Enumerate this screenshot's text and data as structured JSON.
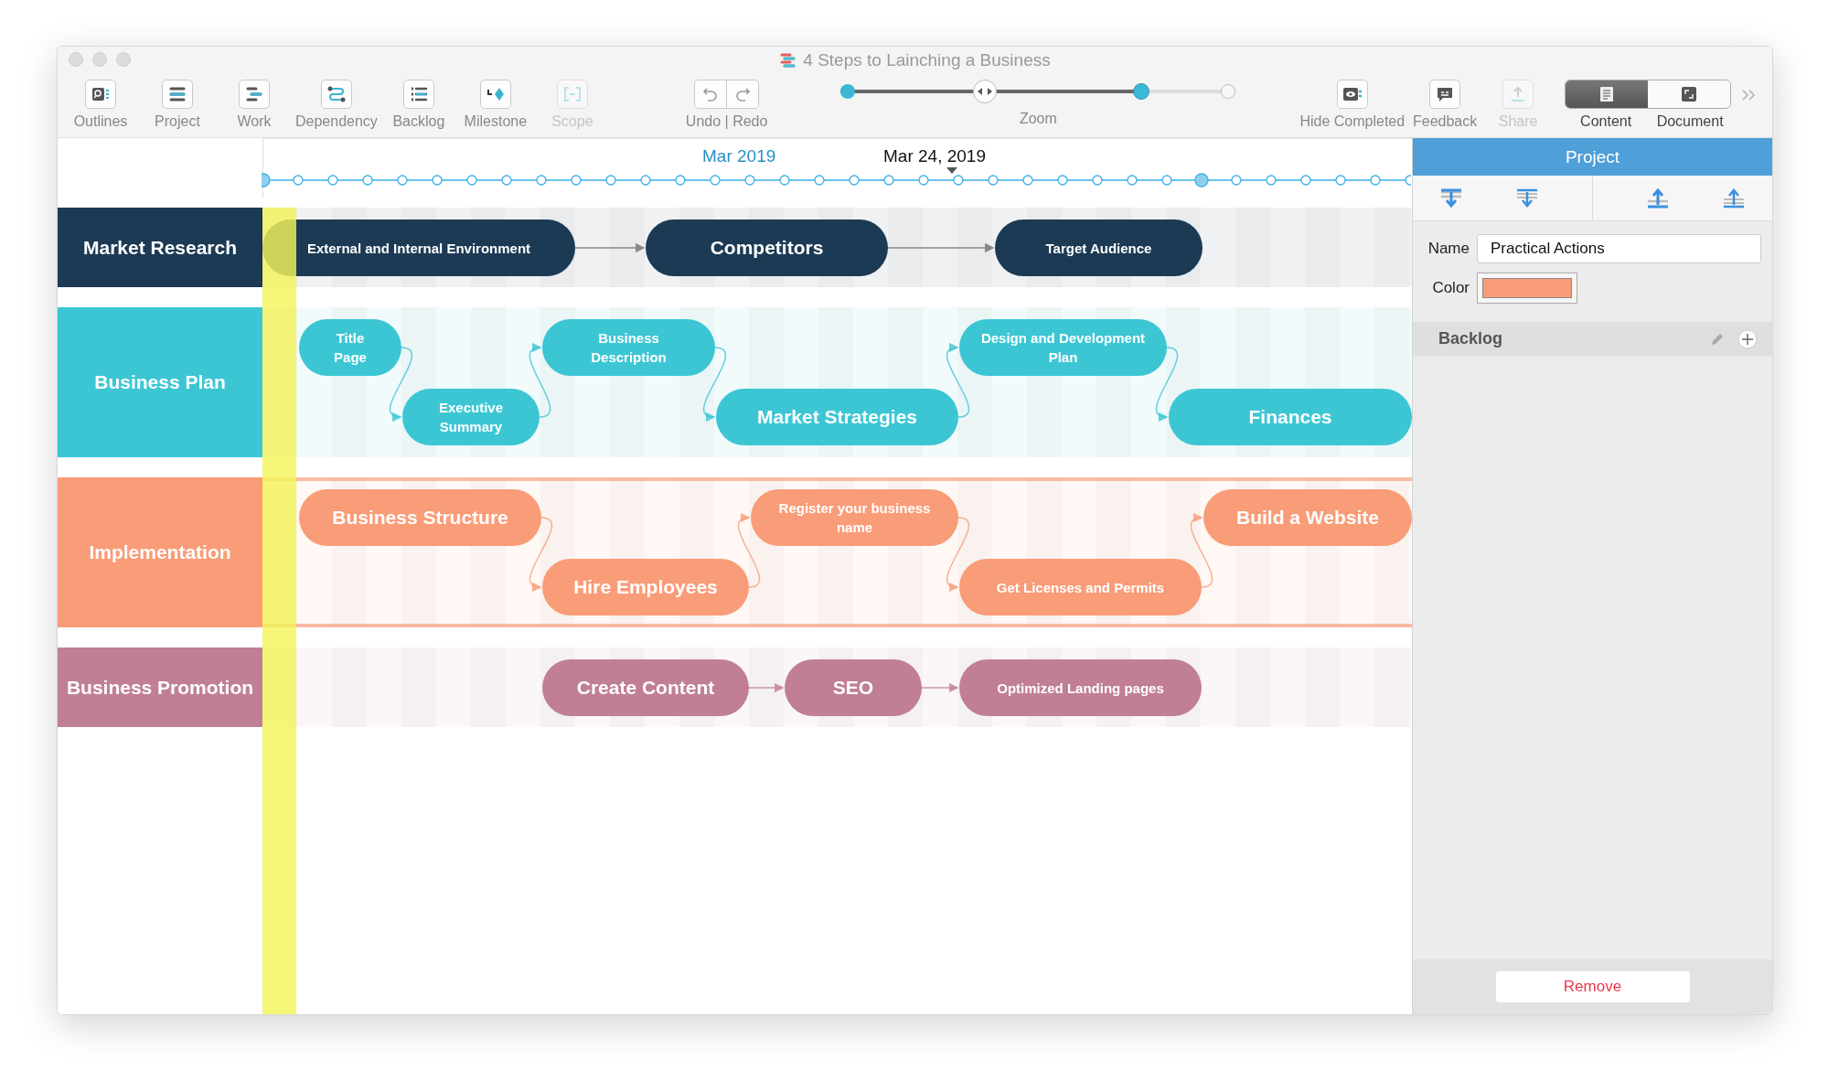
{
  "window": {
    "title": "4 Steps to Lainching a Business"
  },
  "toolbar": {
    "tools": [
      {
        "label": "Outlines",
        "disabled": false
      },
      {
        "label": "Project",
        "disabled": false
      },
      {
        "label": "Work",
        "disabled": false
      },
      {
        "label": "Dependency",
        "disabled": false
      },
      {
        "label": "Backlog",
        "disabled": false
      },
      {
        "label": "Milestone",
        "disabled": false
      },
      {
        "label": "Scope",
        "disabled": true
      }
    ],
    "undo_redo": {
      "label": "Undo | Redo"
    },
    "zoom": {
      "label": "Zoom",
      "level": 0.76
    },
    "actions": [
      {
        "label": "Hide Completed",
        "disabled": false
      },
      {
        "label": "Feedback",
        "disabled": false
      },
      {
        "label": "Share",
        "disabled": true
      }
    ],
    "view_modes": [
      {
        "label": "Content",
        "selected": true
      },
      {
        "label": "Document",
        "selected": false
      }
    ]
  },
  "timeline": {
    "month": "Mar 2019",
    "current_date": "Mar 24, 2019"
  },
  "lanes": [
    {
      "name": "Market Research",
      "color": "#1c3a54",
      "selected": false,
      "tasks": [
        "External and Internal Environment",
        "Competitors",
        "Target Audience"
      ]
    },
    {
      "name": "Business Plan",
      "color": "#3cc6d4",
      "selected": false,
      "tasks": [
        "Title Page",
        "Executive Summary",
        "Business Description",
        "Market Strategies",
        "Design and Development Plan",
        "Finances"
      ]
    },
    {
      "name": "Implementation",
      "color": "#f99c78",
      "selected": true,
      "tasks": [
        "Business Structure",
        "Hire Employees",
        "Register your business name",
        "Get Licenses and Permits",
        "Build a Website"
      ]
    },
    {
      "name": "Business Promotion",
      "color": "#c07f96",
      "selected": false,
      "tasks": [
        "Create Content",
        "SEO",
        "Optimized Landing pages"
      ]
    }
  ],
  "inspector": {
    "title": "Project",
    "name_label": "Name",
    "name_value": "Practical Actions",
    "color_label": "Color",
    "color": "#f99c78",
    "backlog_label": "Backlog",
    "remove_button": "Remove"
  }
}
